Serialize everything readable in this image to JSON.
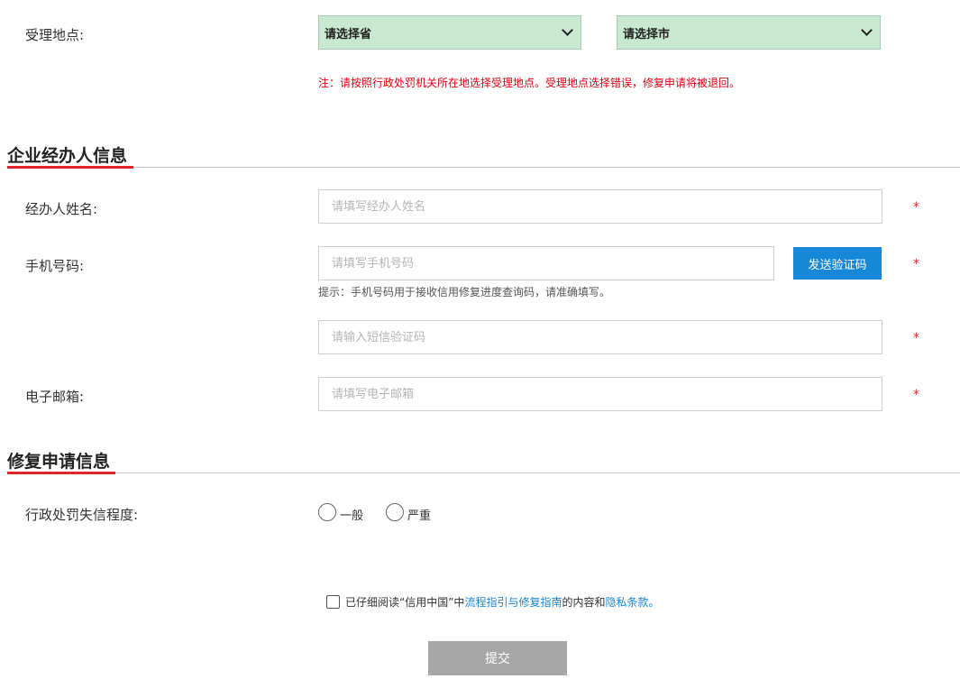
{
  "location": {
    "label": "受理地点:",
    "province_placeholder": "请选择省",
    "city_placeholder": "请选择市",
    "note": "注：请按照行政处罚机关所在地选择受理地点。受理地点选择错误，修复申请将被退回。"
  },
  "agent_section": {
    "title": "企业经办人信息",
    "name_label": "经办人姓名:",
    "name_placeholder": "请填写经办人姓名",
    "phone_label": "手机号码:",
    "phone_placeholder": "请填写手机号码",
    "send_code_label": "发送验证码",
    "phone_hint": "提示：手机号码用于接收信用修复进度查询码，请准确填写。",
    "sms_placeholder": "请输入短信验证码",
    "email_label": "电子邮箱:",
    "email_placeholder": "请填写电子邮箱",
    "required_mark": "*"
  },
  "repair_section": {
    "title": "修复申请信息",
    "severity_label": "行政处罚失信程度:",
    "options": [
      "一般",
      "严重"
    ]
  },
  "agreement": {
    "prefix": "已仔细阅读“信用中国”中",
    "link1": "流程指引与修复指南",
    "middle": "的内容和",
    "link2": "隐私条款",
    "suffix": "。"
  },
  "submit_label": "提交",
  "colors": {
    "select_bg": "#c8e8cf",
    "accent_blue": "#1787d8",
    "warning_red": "#e60012",
    "section_underline": "#e2232a",
    "submit_gray": "#a6a6a6"
  }
}
